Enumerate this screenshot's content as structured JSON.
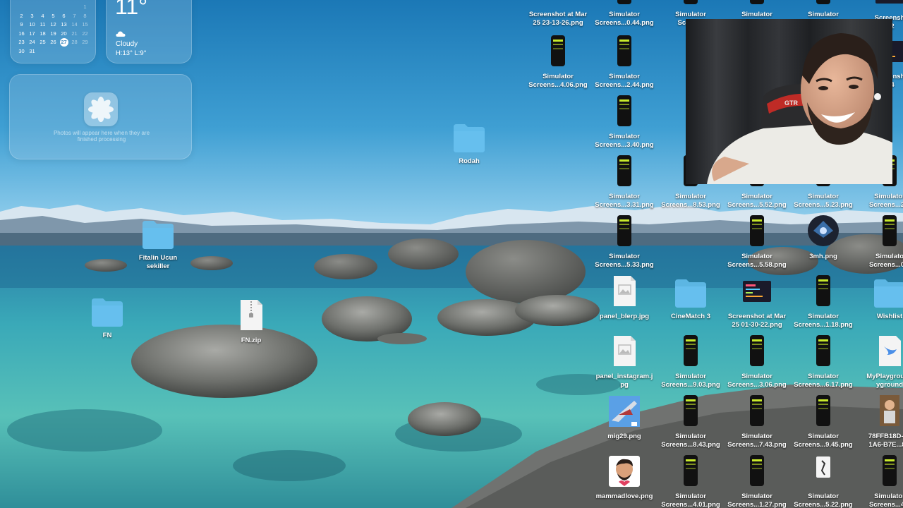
{
  "calendar": {
    "days": [
      "",
      "",
      "",
      "",
      "",
      "",
      "1",
      "2",
      "3",
      "4",
      "5",
      "6",
      "7",
      "8",
      "9",
      "10",
      "11",
      "12",
      "13",
      "14",
      "15",
      "16",
      "17",
      "18",
      "19",
      "20",
      "21",
      "22",
      "23",
      "24",
      "25",
      "26",
      "27",
      "28",
      "29",
      "30",
      "31"
    ],
    "today": "27"
  },
  "weather": {
    "temperature": "11°",
    "condition": "Cloudy",
    "high_low": "H:13° L:9°"
  },
  "photos_widget": {
    "message_line1": "Photos will appear here when they are",
    "message_line2": "finished processing"
  },
  "desktop_icons": [
    {
      "id": "shot-mar25-1",
      "line1": "Screenshot at Mar",
      "line2": "25 23-13-26.png",
      "kind": "png"
    },
    {
      "id": "sim-044",
      "line1": "Simulator",
      "line2": "Screens...0.44.png",
      "kind": "phone"
    },
    {
      "id": "sim-a",
      "line1": "Simulator",
      "line2": "Screens",
      "kind": "phone"
    },
    {
      "id": "sim-b",
      "line1": "Simulator",
      "line2": "",
      "kind": "phone"
    },
    {
      "id": "sim-c",
      "line1": "Simulator",
      "line2": "",
      "kind": "phone"
    },
    {
      "id": "sim-406",
      "line1": "Simulator",
      "line2": "Screens...4.06.png",
      "kind": "phone"
    },
    {
      "id": "sim-244",
      "line1": "Simulator",
      "line2": "Screens...2.44.png",
      "kind": "phone"
    },
    {
      "id": "sim-340",
      "line1": "Simulator",
      "line2": "Screens...3.40.png",
      "kind": "phone"
    },
    {
      "id": "rodah",
      "line1": "Rodah",
      "line2": "",
      "kind": "folder"
    },
    {
      "id": "sim-331",
      "line1": "Simulator",
      "line2": "Screens...3.31.png",
      "kind": "phone"
    },
    {
      "id": "sim-853",
      "line1": "Simulator",
      "line2": "Screens...8.53.png",
      "kind": "phone"
    },
    {
      "id": "sim-552",
      "line1": "Simulator",
      "line2": "Screens...5.52.png",
      "kind": "phone"
    },
    {
      "id": "sim-523",
      "line1": "Simulator",
      "line2": "Screens...5.23.png",
      "kind": "phone"
    },
    {
      "id": "sim-edge-1",
      "line1": "Simulator",
      "line2": "Screens...2.3",
      "kind": "phone"
    },
    {
      "id": "fitalin",
      "line1": "Fitalin Ucun",
      "line2": "sekiller",
      "kind": "folder"
    },
    {
      "id": "sim-533",
      "line1": "Simulator",
      "line2": "Screens...5.33.png",
      "kind": "phone"
    },
    {
      "id": "sim-558",
      "line1": "Simulator",
      "line2": "Screens...5.58.png",
      "kind": "phone"
    },
    {
      "id": "3mh",
      "line1": "3mh.png",
      "line2": "",
      "kind": "dark-circle"
    },
    {
      "id": "sim-edge-2",
      "line1": "Simulato",
      "line2": "Screens...0.0",
      "kind": "phone"
    },
    {
      "id": "fn-folder",
      "line1": "FN",
      "line2": "",
      "kind": "folder"
    },
    {
      "id": "fn-zip",
      "line1": "FN.zip",
      "line2": "",
      "kind": "zip"
    },
    {
      "id": "panel-blerp",
      "line1": "panel_blerp.jpg",
      "line2": "",
      "kind": "jpg"
    },
    {
      "id": "cinematch",
      "line1": "CineMatch 3",
      "line2": "",
      "kind": "folder"
    },
    {
      "id": "shot-mar25-2",
      "line1": "Screenshot at Mar",
      "line2": "25 01-30-22.png",
      "kind": "png"
    },
    {
      "id": "sim-118",
      "line1": "Simulator",
      "line2": "Screens...1.18.png",
      "kind": "phone"
    },
    {
      "id": "wishlist",
      "line1": "Wishlist",
      "line2": "",
      "kind": "folder"
    },
    {
      "id": "panel-instagram",
      "line1": "panel_instagram.j",
      "line2": "pg",
      "kind": "jpg"
    },
    {
      "id": "sim-903",
      "line1": "Simulator",
      "line2": "Screens...9.03.png",
      "kind": "phone"
    },
    {
      "id": "sim-306",
      "line1": "Simulator",
      "line2": "Screens...3.06.png",
      "kind": "phone"
    },
    {
      "id": "sim-617",
      "line1": "Simulator",
      "line2": "Screens...6.17.png",
      "kind": "phone"
    },
    {
      "id": "myplayground",
      "line1": "MyPlayground",
      "line2": "yground",
      "kind": "swift"
    },
    {
      "id": "mig29",
      "line1": "mig29.png",
      "line2": "",
      "kind": "jet"
    },
    {
      "id": "sim-843",
      "line1": "Simulator",
      "line2": "Screens...8.43.png",
      "kind": "phone"
    },
    {
      "id": "sim-743",
      "line1": "Simulator",
      "line2": "Screens...7.43.png",
      "kind": "phone"
    },
    {
      "id": "sim-945",
      "line1": "Simulator",
      "line2": "Screens...9.45.png",
      "kind": "phone"
    },
    {
      "id": "78ffb18d",
      "line1": "78FFB18D-45",
      "line2": "1A6-B7E...8A",
      "kind": "photo"
    },
    {
      "id": "mammadlove",
      "line1": "mammadlove.png",
      "line2": "",
      "kind": "avatar"
    },
    {
      "id": "sim-401",
      "line1": "Simulator",
      "line2": "Screens...4.01.png",
      "kind": "phone"
    },
    {
      "id": "sim-127",
      "line1": "Simulator",
      "line2": "Screens...1.27.png",
      "kind": "phone"
    },
    {
      "id": "sim-522",
      "line1": "Simulator",
      "line2": "Screens...5.22.png",
      "kind": "phone-white"
    },
    {
      "id": "sim-edge-3",
      "line1": "Simulator",
      "line2": "Screens...4.3",
      "kind": "phone"
    },
    {
      "id": "shot-edge-top",
      "line1": "Screensh",
      "line2": "4.2",
      "kind": "png"
    },
    {
      "id": "shot-edge-mid",
      "line1": "Screensh",
      "line2": "4.4",
      "kind": "png"
    }
  ],
  "webcam": {
    "chair_brand": "GTR"
  },
  "colors": {
    "folder": "#66bfee",
    "phone_accent": "#c8ea2a",
    "label_text": "#ffffff"
  }
}
